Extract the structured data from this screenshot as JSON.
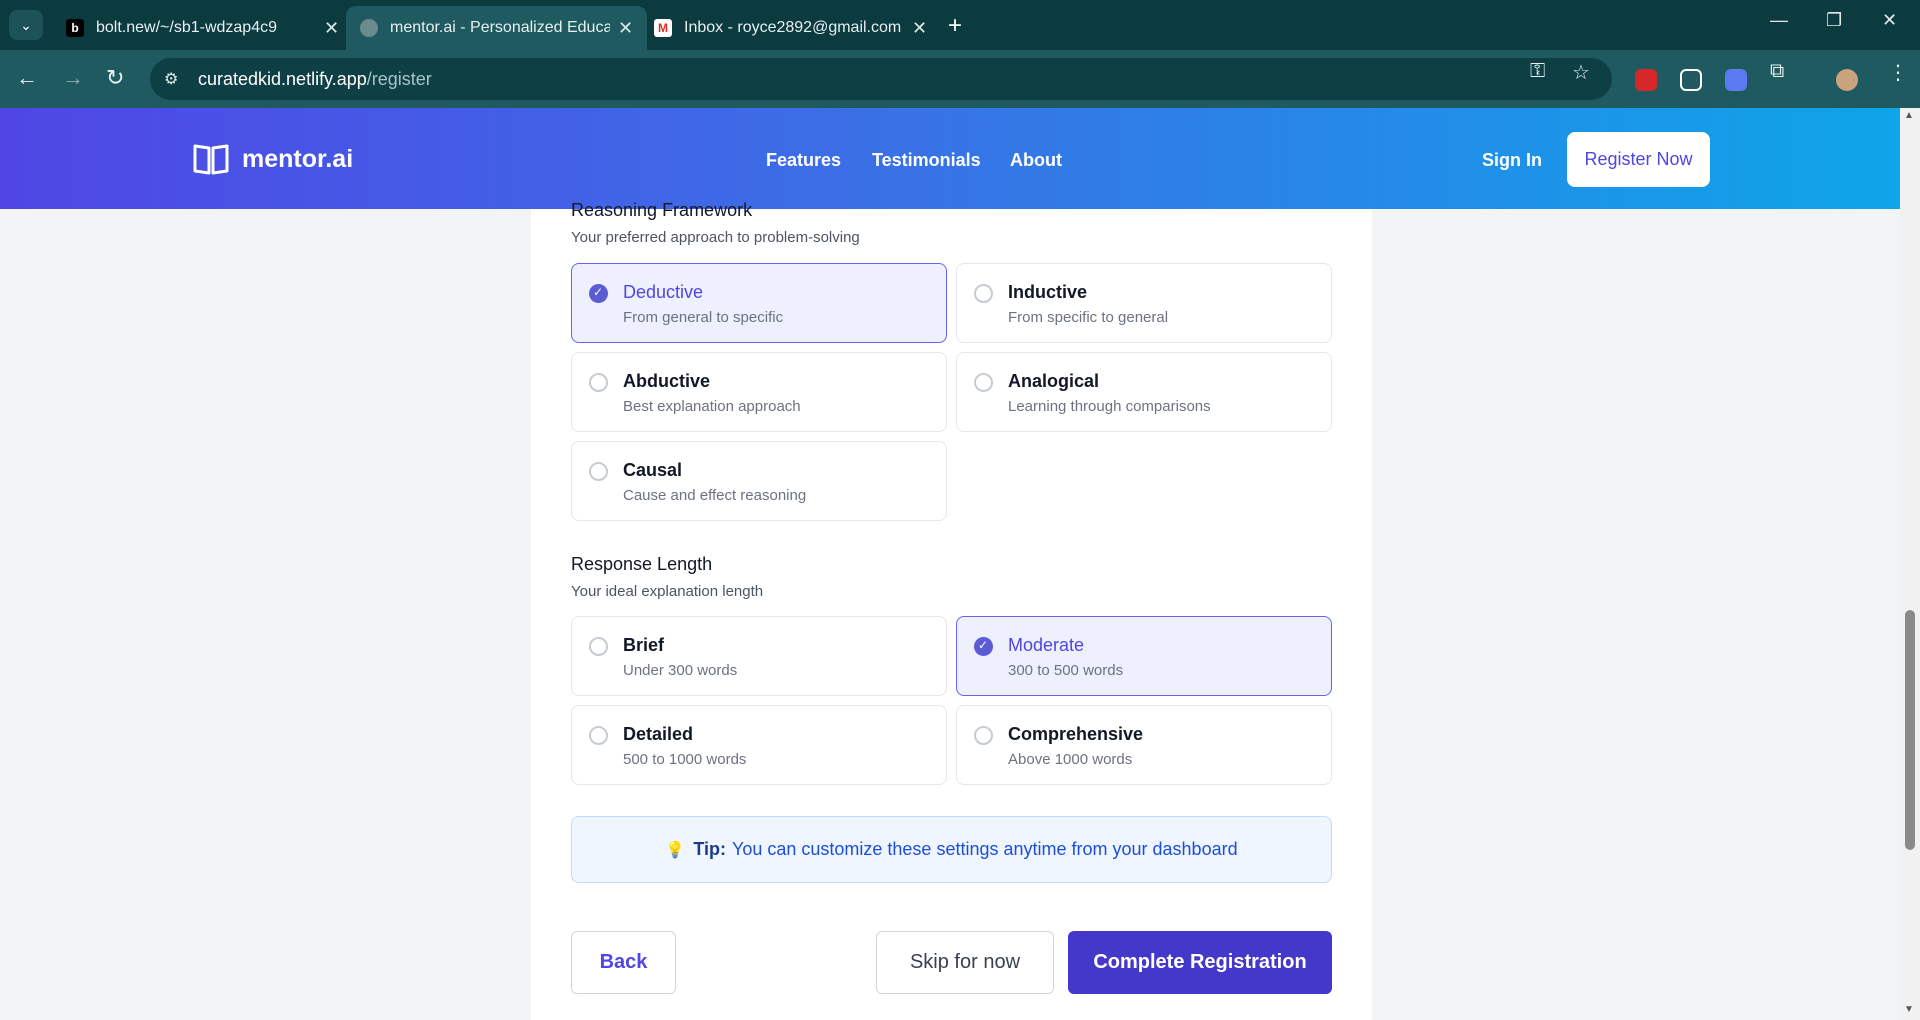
{
  "browser": {
    "tabs": [
      {
        "title": "bolt.new/~/sb1-wdzap4c9",
        "favicon": "b"
      },
      {
        "title": "mentor.ai - Personalized Educat",
        "favicon": "globe"
      },
      {
        "title": "Inbox - royce2892@gmail.com",
        "favicon": "M"
      }
    ],
    "url_host": "curatedkid.netlify.app",
    "url_path": "/register"
  },
  "site": {
    "brand": "mentor.ai",
    "nav": [
      "Features",
      "Testimonials",
      "About"
    ],
    "sign_in": "Sign In",
    "register": "Register Now"
  },
  "reasoning": {
    "title": "Reasoning Framework",
    "subtitle": "Your preferred approach to problem-solving",
    "options": [
      {
        "label": "Deductive",
        "desc": "From general to specific",
        "selected": true
      },
      {
        "label": "Inductive",
        "desc": "From specific to general",
        "selected": false
      },
      {
        "label": "Abductive",
        "desc": "Best explanation approach",
        "selected": false
      },
      {
        "label": "Analogical",
        "desc": "Learning through comparisons",
        "selected": false
      },
      {
        "label": "Causal",
        "desc": "Cause and effect reasoning",
        "selected": false
      }
    ]
  },
  "response": {
    "title": "Response Length",
    "subtitle": "Your ideal explanation length",
    "options": [
      {
        "label": "Brief",
        "desc": "Under 300 words",
        "selected": false
      },
      {
        "label": "Moderate",
        "desc": "300 to 500 words",
        "selected": true
      },
      {
        "label": "Detailed",
        "desc": "500 to 1000 words",
        "selected": false
      },
      {
        "label": "Comprehensive",
        "desc": "Above 1000 words",
        "selected": false
      }
    ]
  },
  "tip": {
    "label": "Tip:",
    "text": "You can customize these settings anytime from your dashboard"
  },
  "actions": {
    "back": "Back",
    "skip": "Skip for now",
    "complete": "Complete Registration"
  },
  "colors": {
    "accent": "#4f46e5",
    "header_start": "#4f46e5",
    "header_end": "#0ea5e9"
  }
}
